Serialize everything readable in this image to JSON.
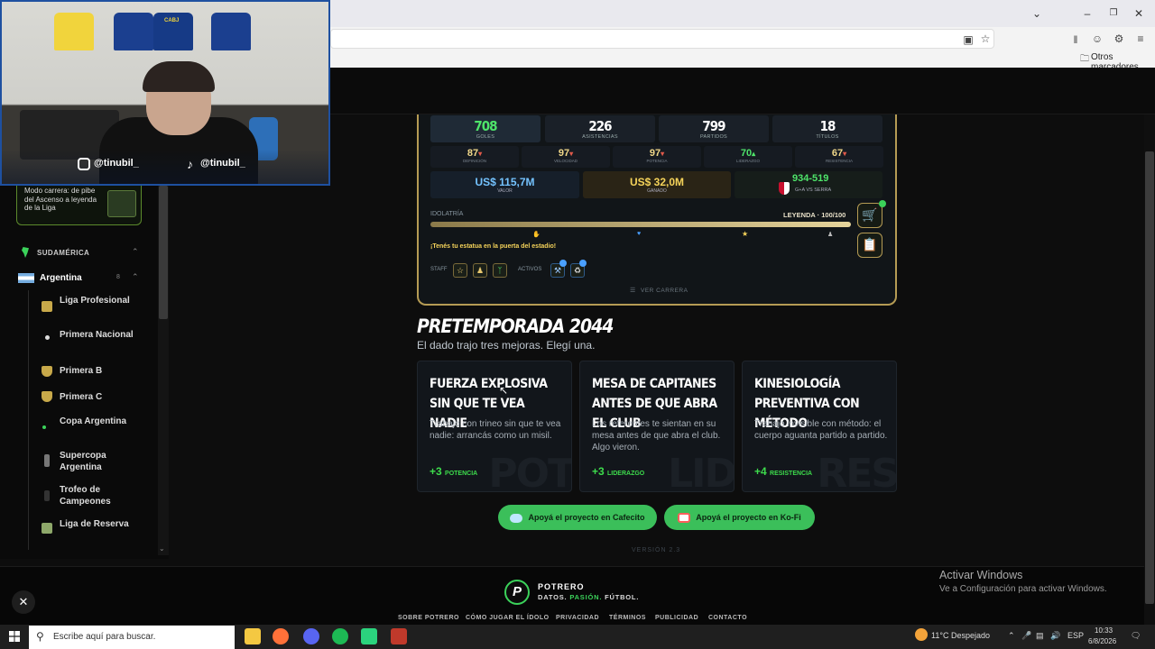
{
  "browser": {
    "bookmark_other": "Otros marcadores",
    "win_min": "–",
    "win_restore": "❐",
    "win_close": "✕"
  },
  "webcam": {
    "instagram": "@tinubil_",
    "tiktok": "@tinubil_",
    "jersey_label": "CABJ"
  },
  "sidebar": {
    "promo_text": "Modo carrera: de pibe del Ascenso a leyenda de la Liga",
    "region": "SUDAMÉRICA",
    "country": "Argentina",
    "country_count": "8",
    "leagues": [
      "Liga Profesional",
      "Primera Nacional",
      "Primera B",
      "Primera C",
      "Copa Argentina",
      "Supercopa Argentina",
      "Trofeo de Campeones",
      "Liga de Reserva"
    ]
  },
  "stats": {
    "top": [
      {
        "value": "708",
        "label": "GOLES"
      },
      {
        "value": "226",
        "label": "ASISTENCIAS"
      },
      {
        "value": "799",
        "label": "PARTIDOS"
      },
      {
        "value": "18",
        "label": "TÍTULOS"
      }
    ],
    "attributes": [
      {
        "value": "87",
        "label": "DEFINICIÓN",
        "trend": "▾"
      },
      {
        "value": "97",
        "label": "VELOCIDAD",
        "trend": "▾"
      },
      {
        "value": "97",
        "label": "POTENCIA",
        "trend": "▾"
      },
      {
        "value": "70",
        "label": "LIDERAZGO",
        "trend": "▴"
      },
      {
        "value": "67",
        "label": "RESISTENCIA",
        "trend": "▾"
      }
    ],
    "valor": {
      "value": "US$ 115,7M",
      "label": "VALOR"
    },
    "ganado": {
      "value": "US$ 32,0M",
      "label": "GANADO"
    },
    "record": {
      "value": "934-519",
      "label": "G+A VS SERRA"
    },
    "idolatria_label": "IDOLATRÍA",
    "idolatria_level": "LEYENDA · 100/100",
    "idolatria_progress": 1.0,
    "statue_text": "¡Tenés tu estatua en la puerta del estadio!",
    "staff_label": "STAFF",
    "activos_label": "ACTIVOS",
    "ver_carrera": "VER CARRERA",
    "colors": {
      "goles": "#4ee46a",
      "valor": "#74c3ff",
      "ganado": "#f5d35a",
      "record": "#4ee46a",
      "trend_down": "#e05a4a",
      "trend_up": "#4ee46a"
    }
  },
  "season": {
    "title": "PRETEMPORADA 2044",
    "subtitle": "El dado trajo tres mejoras. Elegí una.",
    "cards": [
      {
        "title": "FUERZA EXPLOSIVA SIN QUE TE VEA NADIE",
        "desc": "Trabajo con trineo sin que te vea nadie: arrancás como un misil.",
        "bonus": "+3",
        "bonus_label": "POTENCIA",
        "watermark": "POT"
      },
      {
        "title": "MESA DE CAPITANES ANTES DE QUE ABRA EL CLUB",
        "desc": "Los referentes te sientan en su mesa antes de que abra el club. Algo vieron.",
        "bonus": "+3",
        "bonus_label": "LIDERAZGO",
        "watermark": "LID"
      },
      {
        "title": "KINESIOLOGÍA PREVENTIVA CON MÉTODO",
        "desc": "Trabajo invisible con método: el cuerpo aguanta partido a partido.",
        "bonus": "+4",
        "bonus_label": "RESISTENCIA",
        "watermark": "RES"
      }
    ]
  },
  "support": {
    "cafecito": "Apoyá el proyecto en Cafecito",
    "kofi": "Apoyá el proyecto en Ko-Fi"
  },
  "version": "VERSIÓN 2.3",
  "footer": {
    "brand": "POTRERO",
    "tagline_a": "DATOS. ",
    "tagline_b": "PASIÓN.",
    "tagline_c": " FÚTBOL.",
    "links": [
      "SOBRE POTRERO",
      "CÓMO JUGAR EL ÍDOLO",
      "PRIVACIDAD",
      "TÉRMINOS",
      "PUBLICIDAD",
      "CONTACTO"
    ]
  },
  "windows_activation": {
    "title": "Activar Windows",
    "sub": "Ve a Configuración para activar Windows."
  },
  "taskbar": {
    "search_placeholder": "Escribe aquí para buscar.",
    "weather": "11°C  Despejado",
    "lang": "ESP",
    "time": "10:33",
    "date": "6/8/2026"
  }
}
